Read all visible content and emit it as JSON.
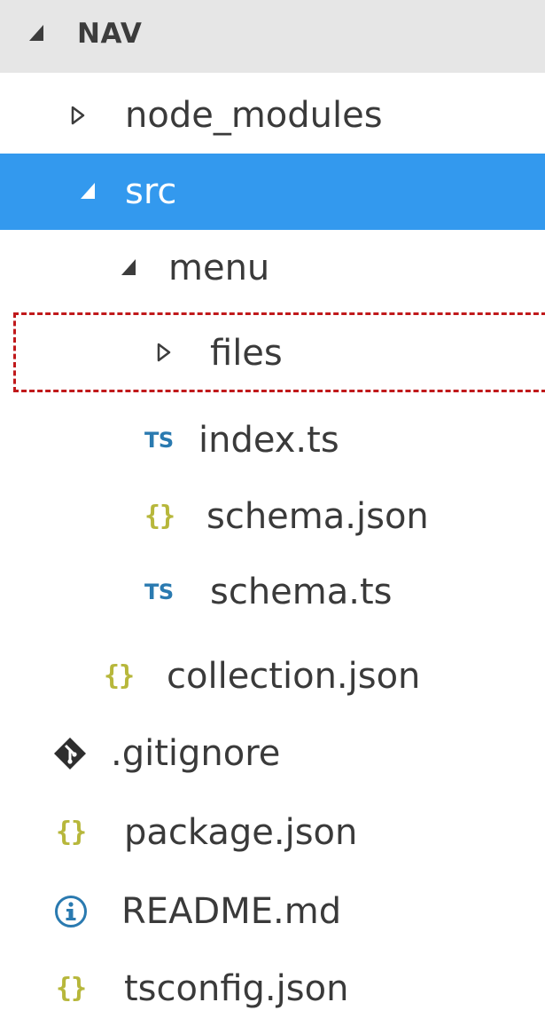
{
  "explorer": {
    "section_title": "NAV"
  },
  "tree": {
    "node_modules": "node_modules",
    "src": "src",
    "menu": "menu",
    "files": "files",
    "index_ts": "index.ts",
    "schema_json": "schema.json",
    "schema_ts": "schema.ts",
    "collection_json": "collection.json",
    "gitignore": ".gitignore",
    "package_json": "package.json",
    "readme_md": "README.md",
    "tsconfig_json": "tsconfig.json"
  },
  "icons": {
    "ts_text": "TS",
    "json_text": "{}",
    "ts_color": "#2a7ab0",
    "json_color": "#b7b73b",
    "selected_bg": "#3399ee",
    "annotation_color": "#c0191b"
  }
}
